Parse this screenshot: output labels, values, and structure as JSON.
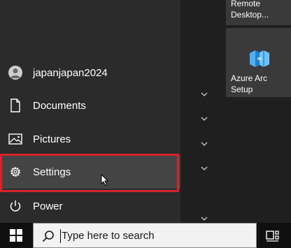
{
  "start_menu": {
    "items": [
      {
        "label": "japanjapan2024",
        "icon": "user-avatar-icon"
      },
      {
        "label": "Documents",
        "icon": "document-icon"
      },
      {
        "label": "Pictures",
        "icon": "pictures-icon"
      },
      {
        "label": "Settings",
        "icon": "gear-icon"
      },
      {
        "label": "Power",
        "icon": "power-icon"
      }
    ],
    "highlight_color": "#d7242b"
  },
  "tiles": {
    "remote_desktop_label": "Remote Desktop...",
    "azure_arc_label": "Azure Arc Setup",
    "azure_logo": "azure-arc-logo-icon"
  },
  "taskbar": {
    "search_placeholder": "Type here to search"
  }
}
